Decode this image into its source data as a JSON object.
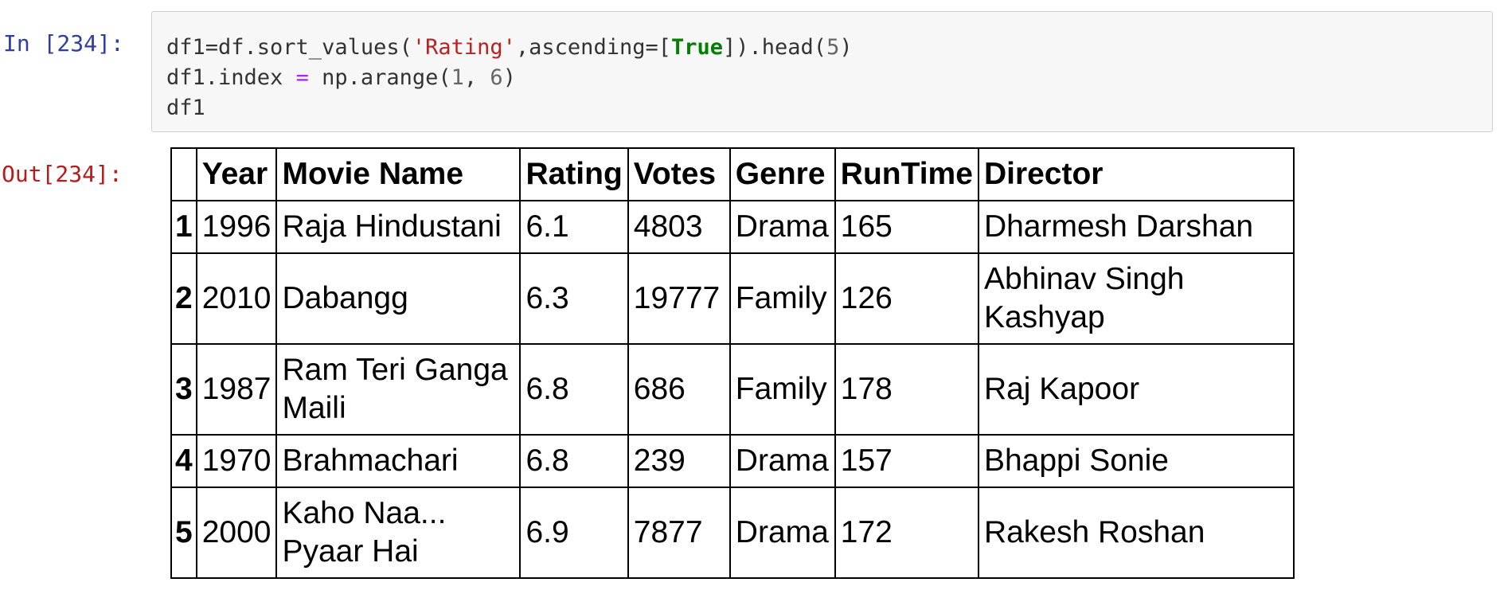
{
  "input_prompt": "In [234]:",
  "output_prompt": "Out[234]:",
  "code": {
    "line1": {
      "a": "df1=df.sort_values(",
      "b": "'Rating'",
      "c": ",ascending=[",
      "d": "True",
      "e": "]).head(",
      "f": "5",
      "g": ")"
    },
    "line2": {
      "a": "df1.index ",
      "b": "=",
      "c": " np.arange(",
      "d": "1",
      "e": ", ",
      "f": "6",
      "g": ")"
    },
    "line3": "df1"
  },
  "table": {
    "columns": [
      "",
      "Year",
      "Movie Name",
      "Rating",
      "Votes",
      "Genre",
      "RunTime",
      "Director"
    ],
    "rows": [
      {
        "index": "1",
        "year": "1996",
        "movie": "Raja Hindustani",
        "rating": "6.1",
        "votes": "4803",
        "genre": "Drama",
        "runtime": "165",
        "director": "Dharmesh Darshan"
      },
      {
        "index": "2",
        "year": "2010",
        "movie": "Dabangg",
        "rating": "6.3",
        "votes": "19777",
        "genre": "Family",
        "runtime": "126",
        "director": "Abhinav Singh Kashyap"
      },
      {
        "index": "3",
        "year": "1987",
        "movie": "Ram Teri Ganga Maili",
        "rating": "6.8",
        "votes": "686",
        "genre": "Family",
        "runtime": "178",
        "director": "Raj Kapoor"
      },
      {
        "index": "4",
        "year": "1970",
        "movie": "Brahmachari",
        "rating": "6.8",
        "votes": "239",
        "genre": "Drama",
        "runtime": "157",
        "director": "Bhappi Sonie"
      },
      {
        "index": "5",
        "year": "2000",
        "movie": "Kaho Naa... Pyaar Hai",
        "rating": "6.9",
        "votes": "7877",
        "genre": "Drama",
        "runtime": "172",
        "director": "Rakesh Roshan"
      }
    ]
  }
}
